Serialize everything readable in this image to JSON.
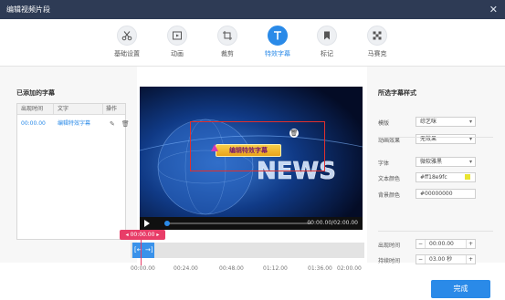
{
  "window": {
    "title": "编辑视频片段",
    "close_icon": "close-icon"
  },
  "tabs": [
    {
      "label": "基础设置",
      "icon": "scissors-icon",
      "active": false
    },
    {
      "label": "动画",
      "icon": "play-square-icon",
      "active": false
    },
    {
      "label": "裁剪",
      "icon": "crop-icon",
      "active": false
    },
    {
      "label": "特效字幕",
      "icon": "text-t-icon",
      "active": true
    },
    {
      "label": "标记",
      "icon": "bookmark-icon",
      "active": false
    },
    {
      "label": "马赛克",
      "icon": "mosaic-icon",
      "active": false
    }
  ],
  "left": {
    "title": "已添加的字幕",
    "headers": [
      "出现时间",
      "文字",
      "操作"
    ],
    "rows": [
      {
        "time": "00:00.00",
        "text": "编辑特效字幕",
        "edit_icon": "pencil-icon",
        "delete_icon": "trash-icon"
      }
    ]
  },
  "preview": {
    "overlay_text": "编辑特效字幕",
    "bg_text": "NEWS",
    "player_time": "00:00.00/02:00.00"
  },
  "timeline": {
    "badge": "00:00.00",
    "ticks": [
      "00:00.00",
      "00:24.00",
      "00:48.00",
      "01:12.00",
      "01:36.00",
      "02:00.00"
    ]
  },
  "right": {
    "title": "所选字幕样式",
    "template_label": "模版",
    "template_value": "综艺咪",
    "anim_label": "动画效果",
    "anim_value": "无效果",
    "font_label": "字体",
    "font_value": "微软雅黑",
    "textcolor_label": "文本颜色",
    "textcolor_value": "#ff18e9fc",
    "bgcolor_label": "背景颜色",
    "bgcolor_value": "#00000000",
    "appear_label": "出现时间",
    "appear_value": "00:00.00",
    "duration_label": "持续时间",
    "duration_value": "03.00 秒"
  },
  "finish_label": "完成",
  "colors": {
    "accent": "#2a8ae8",
    "titlebar": "#2e3b55",
    "badge": "#e83d68",
    "text_swatch": "#e9e430"
  }
}
